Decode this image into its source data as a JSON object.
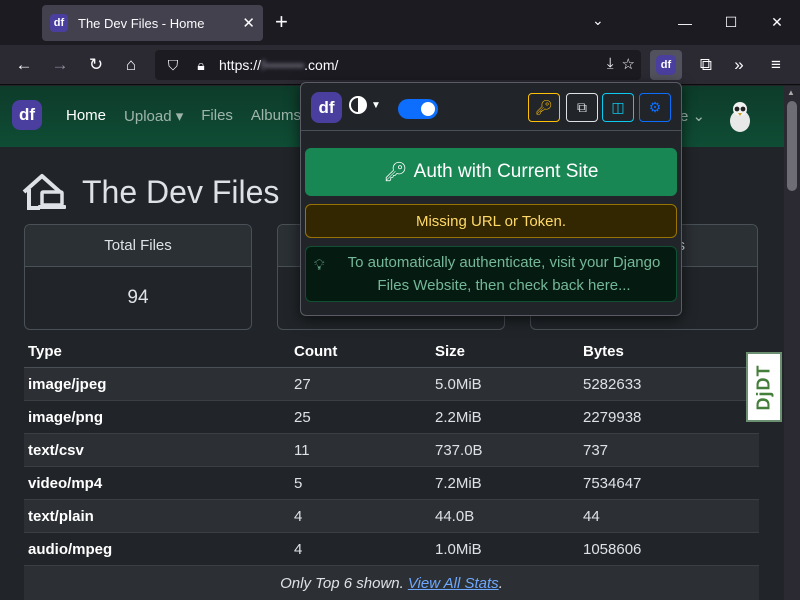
{
  "browser": {
    "tab_title": "The Dev Files - Home",
    "tab_favicon": "df",
    "url_prefix": "https://",
    "url_hidden": "f••••••••",
    "url_suffix": ".com/",
    "extension_label": "df"
  },
  "site": {
    "logo": "df",
    "nav": [
      "Home",
      "Upload ▾",
      "Files",
      "Albums"
    ],
    "nav_right": "e ⌄",
    "page_title": "The Dev Files",
    "cards": [
      {
        "title": "Total Files",
        "value": "94"
      }
    ],
    "card2_title_fragment": "s"
  },
  "stats_table": {
    "headers": [
      "Type",
      "Count",
      "Size",
      "Bytes"
    ],
    "rows": [
      [
        "image/jpeg",
        "27",
        "5.0MiB",
        "5282633"
      ],
      [
        "image/png",
        "25",
        "2.2MiB",
        "2279938"
      ],
      [
        "text/csv",
        "11",
        "737.0B",
        "737"
      ],
      [
        "video/mp4",
        "5",
        "7.2MiB",
        "7534647"
      ],
      [
        "text/plain",
        "4",
        "44.0B",
        "44"
      ],
      [
        "audio/mpeg",
        "4",
        "1.0MiB",
        "1058606"
      ]
    ],
    "footer_text": "Only Top 6 shown.",
    "footer_link": "View All Stats",
    "footer_end": "."
  },
  "djdt_label": "DjDT",
  "popup": {
    "logo": "df",
    "auth_button": "Auth with Current Site",
    "warning": "Missing URL or Token.",
    "info": "To automatically authenticate, visit your Django Files Website, then check back here..."
  }
}
